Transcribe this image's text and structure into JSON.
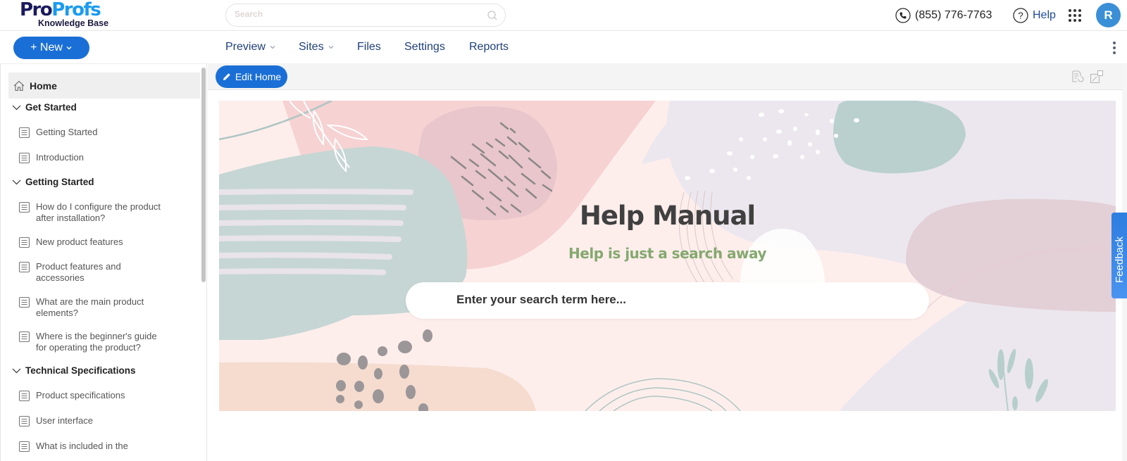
{
  "header": {
    "logo_pro": "Pro",
    "logo_profs": "Profs",
    "logo_sub": "Knowledge Base",
    "search_placeholder": "Search",
    "phone": "(855) 776-7763",
    "help_label": "Help",
    "avatar_initial": "R"
  },
  "navbar": {
    "new_label": "+ New",
    "items": [
      {
        "label": "Preview",
        "dropdown": true
      },
      {
        "label": "Sites",
        "dropdown": true
      },
      {
        "label": "Files",
        "dropdown": false
      },
      {
        "label": "Settings",
        "dropdown": false
      },
      {
        "label": "Reports",
        "dropdown": false
      }
    ]
  },
  "sidebar": {
    "home_label": "Home",
    "sections": [
      {
        "title": "Get Started",
        "items": [
          "Getting Started",
          "Introduction"
        ]
      },
      {
        "title": "Getting Started",
        "items": [
          "How do I configure the product after installation?",
          "New product features",
          "Product features and accessories",
          "What are the main product elements?",
          "Where is the beginner's guide for operating the product?"
        ]
      },
      {
        "title": "Technical Specifications",
        "items": [
          "Product specifications",
          "User interface",
          "What is included in the"
        ]
      }
    ]
  },
  "main": {
    "edit_label": "Edit Home",
    "banner_title": "Help Manual",
    "banner_subtitle": "Help is just a search away",
    "search_placeholder": "Enter your search term here...",
    "feedback_label": "Feedback"
  },
  "colors": {
    "brand_blue": "#1a6fd6",
    "logo_dark": "#1b1a5e",
    "logo_light": "#1a9bef",
    "subtitle_green": "#85a86f",
    "nav_text": "#1f3f7a"
  }
}
